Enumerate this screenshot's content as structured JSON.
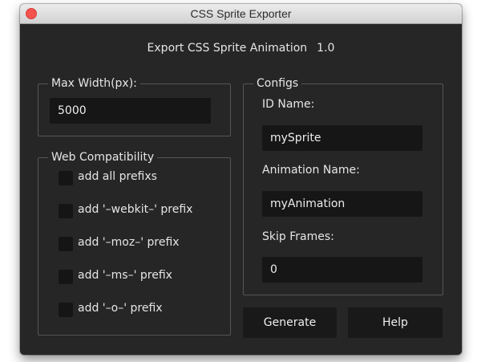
{
  "window": {
    "title": "CSS Sprite Exporter"
  },
  "header": {
    "title": "Export CSS Sprite Animation",
    "version": "1.0"
  },
  "max_width": {
    "legend": "Max Width(px):",
    "value": "5000"
  },
  "web_compat": {
    "legend": "Web Compatibility",
    "options": [
      {
        "label": "add all prefixs",
        "checked": false
      },
      {
        "label": "add '–webkit–' prefix",
        "checked": false
      },
      {
        "label": "add '–moz–' prefix",
        "checked": false
      },
      {
        "label": "add '–ms–' prefix",
        "checked": false
      },
      {
        "label": "add '–o–' prefix",
        "checked": false
      }
    ]
  },
  "configs": {
    "legend": "Configs",
    "id_label": "ID Name:",
    "id_value": "mySprite",
    "anim_label": "Animation Name:",
    "anim_value": "myAnimation",
    "skip_label": "Skip Frames:",
    "skip_value": "0"
  },
  "buttons": {
    "generate": "Generate",
    "help": "Help"
  },
  "colors": {
    "window_bg": "#262626",
    "field_bg": "#161616",
    "close_button": "#f4524d"
  }
}
